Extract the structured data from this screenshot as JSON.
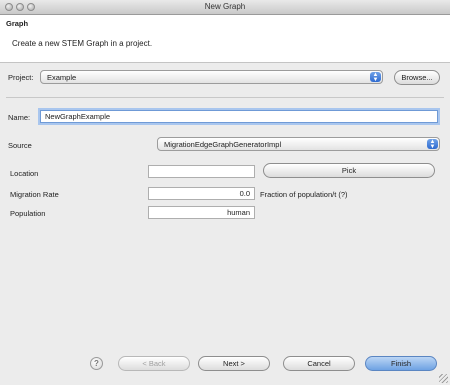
{
  "window": {
    "title": "New Graph"
  },
  "banner": {
    "heading": "Graph",
    "description": "Create a new STEM Graph in a project."
  },
  "project": {
    "label": "Project:",
    "value": "Example",
    "browse_label": "Browse..."
  },
  "name": {
    "label": "Name:",
    "value": "NewGraphExample"
  },
  "source": {
    "label": "Source",
    "value": "MigrationEdgeGraphGeneratorImpl"
  },
  "location": {
    "label": "Location",
    "value": "",
    "pick_label": "Pick"
  },
  "migration_rate": {
    "label": "Migration Rate",
    "value": "0.0",
    "hint": "Fraction of population/t (?)"
  },
  "population": {
    "label": "Population",
    "value": "human"
  },
  "footer": {
    "help_label": "?",
    "back_label": "< Back",
    "next_label": "Next >",
    "cancel_label": "Cancel",
    "finish_label": "Finish"
  }
}
